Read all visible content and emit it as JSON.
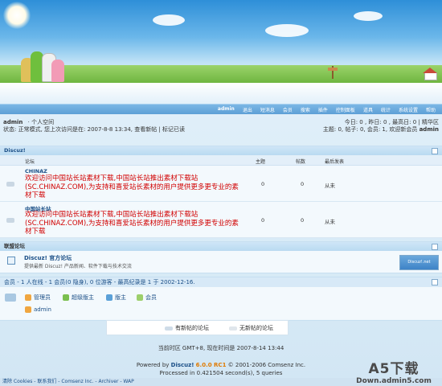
{
  "colors": {
    "accent": "#1a4e86",
    "highlight": "#d10000",
    "menu": "#5d9fd6"
  },
  "menu": {
    "user": "admin",
    "items": [
      "退出",
      "短消息",
      "会员",
      "搜索",
      "插件",
      "控制面板",
      "道具",
      "统计",
      "系统设置",
      "帮助"
    ]
  },
  "status": {
    "user": "admin",
    "space": "· 个人空间",
    "line2": "状态: 正常模式, 您上次访问是在: 2007-8-8 13:34, 查看新帖 | 标记已读",
    "stats_line1": "今日: 0 , 昨日: 0 , 最高日: 0 | 精华区",
    "stats_line2": "主题: 0, 帖子: 0, 会员: 1, 欢迎新会员",
    "newest_member": "admin"
  },
  "category": {
    "title": "Discuz!"
  },
  "columns": {
    "forum": "论坛",
    "threads": "主题",
    "posts": "帖数",
    "lastpost": "最后发表"
  },
  "forums": [
    {
      "name": "CHINAZ",
      "desc": "欢迎访问中国站长站素材下载,中国站长站推出素材下载站(SC.CHINAZ.COM),为支持和喜爱站长素材的用户提供更多更专业的素材下载",
      "threads": "0",
      "posts": "0",
      "lastpost": "从未"
    },
    {
      "name": "中国站长站",
      "desc": "欢迎访问中国站长站素材下载,中国站长站推出素材下载站(SC.CHINAZ.COM),为支持和喜爱站长素材的用户提供更多更专业的素材下载",
      "threads": "0",
      "posts": "0",
      "lastpost": "从未"
    }
  ],
  "links": {
    "title": "联盟论坛",
    "site": "Discuz! 官方论坛",
    "desc": "提供最新 Discuz! 产品新闻、软件下载与技术交流",
    "logo": "Discuz!.net"
  },
  "online": {
    "header": "会员 - 1 人在线 - 1 会员(0 隐身), 0 位游客 - 最高纪录是 1 于 2002-12-16.",
    "roles": [
      "管理员",
      "超级版主",
      "版主",
      "会员"
    ],
    "user": "admin"
  },
  "legend": {
    "new": "有新帖的论坛",
    "none": "无新帖的论坛"
  },
  "footer": {
    "time": "当前时区 GMT+8, 现在时间是 2007-8-14 13:44",
    "powered_prefix": "Powered by",
    "powered_name": "Discuz!",
    "powered_version": "6.0.0 RC1",
    "copyright": "© 2001-2006 Comsenz Inc.",
    "processed": "Processed in 0.421504 second(s), 5 queries",
    "bottom_links": "清除 Cookies - 联系我们 - Comsenz Inc. - Archiver - WAP"
  },
  "watermark": {
    "line1": "A5下载",
    "line2": "Down.admin5.com"
  }
}
